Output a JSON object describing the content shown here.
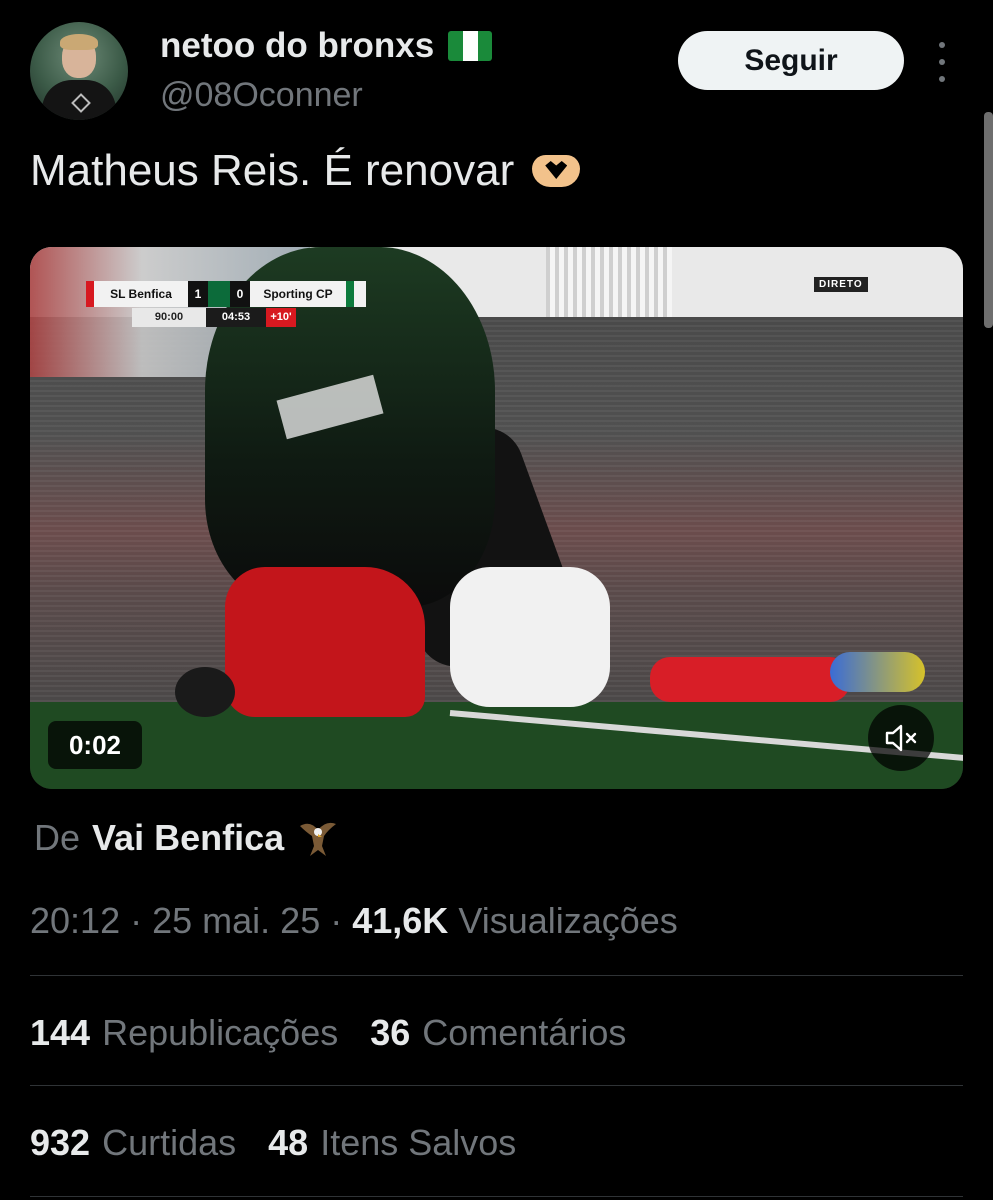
{
  "author": {
    "name": "netoo do bronxs",
    "handle": "@08Oconner",
    "flag": "nigeria-flag-icon"
  },
  "follow_button": "Seguir",
  "tweet": {
    "text": "Matheus Reis. É renovar",
    "emoji": "heart-hands-icon"
  },
  "video": {
    "scorebug": {
      "home": "SL Benfica",
      "home_score": "1",
      "away_score": "0",
      "away": "Sporting CP",
      "clock": "90:00",
      "extra_clock": "04:53",
      "added_time": "+10'"
    },
    "live_label": "DIRETO",
    "timestamp": "0:02",
    "mute_icon": "volume-muted-icon"
  },
  "source": {
    "prefix": "De",
    "name": "Vai Benfica",
    "icon": "eagle-icon"
  },
  "meta": {
    "time": "20:12",
    "date": "25 mai. 25",
    "views_count": "41,6K",
    "views_label": "Visualizações"
  },
  "stats": {
    "reposts_count": "144",
    "reposts_label": "Republicações",
    "comments_count": "36",
    "comments_label": "Comentários",
    "likes_count": "932",
    "likes_label": "Curtidas",
    "saves_count": "48",
    "saves_label": "Itens Salvos"
  },
  "colors": {
    "background": "#000000",
    "text_primary": "#e7e9ea",
    "text_secondary": "#71767b",
    "follow_button_bg": "#eff3f4",
    "divider": "#2f3336"
  }
}
